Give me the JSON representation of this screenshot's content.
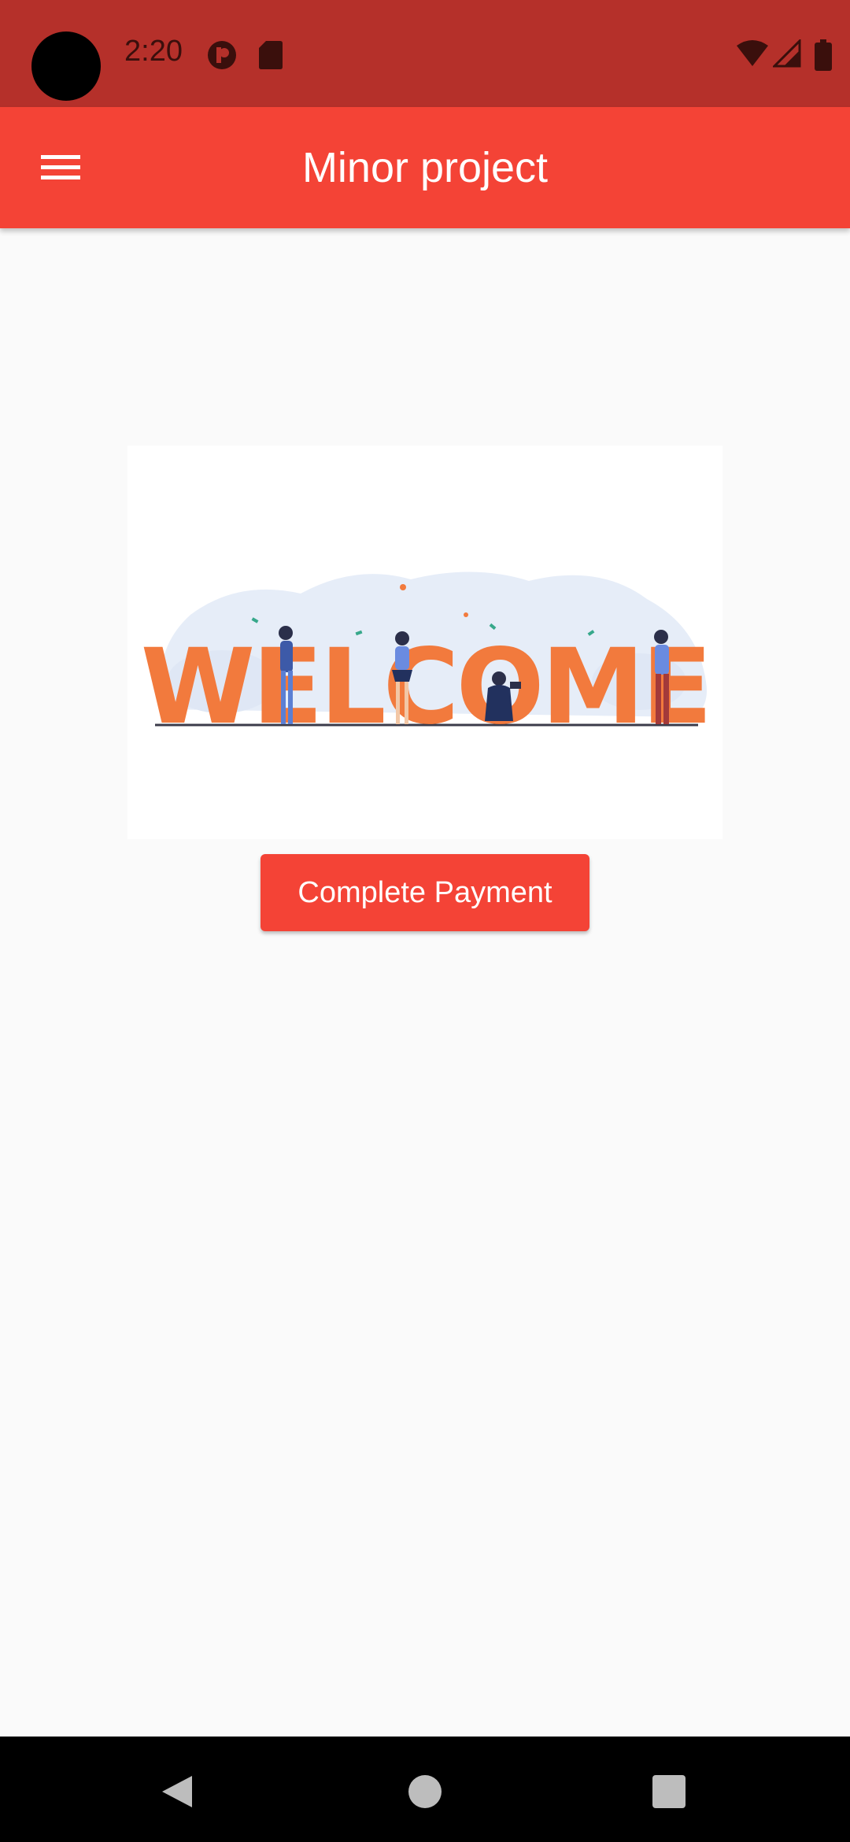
{
  "status_bar": {
    "time": "2:20",
    "icons": [
      "camera-cutout",
      "notification-icon",
      "sd-card-icon",
      "wifi-icon",
      "signal-icon",
      "battery-icon"
    ]
  },
  "app_bar": {
    "title": "Minor project",
    "menu_icon": "hamburger-menu-icon"
  },
  "banner": {
    "text": "WELCOME"
  },
  "main": {
    "payment_button_label": "Complete Payment"
  },
  "nav_bar": {
    "icons": [
      "back-icon",
      "home-icon",
      "recents-icon"
    ]
  },
  "colors": {
    "primary": "#f44336",
    "primary_dark": "#b5302a",
    "background": "#fafafa",
    "banner_letters": "#f27a3d"
  }
}
